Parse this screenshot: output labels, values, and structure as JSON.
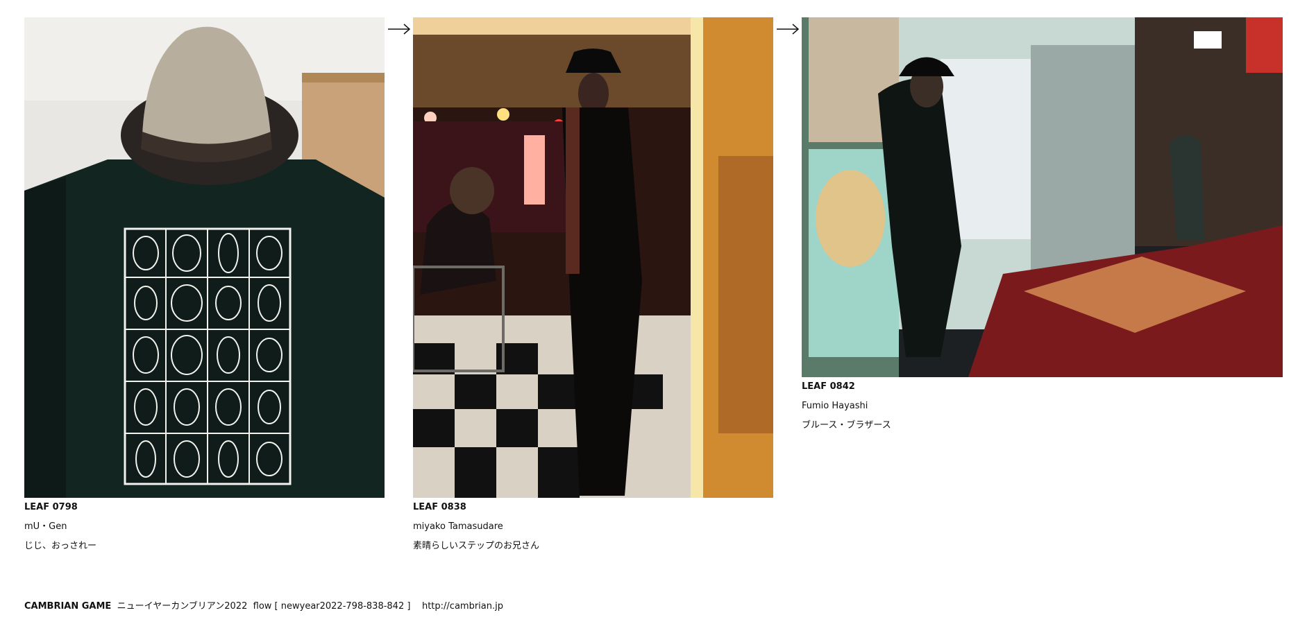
{
  "leaves": [
    {
      "id": "LEAF 0798",
      "author": "mU・Gen",
      "title": "じじ、おっされー",
      "image": "hat-on-tshirt-photo"
    },
    {
      "id": "LEAF 0838",
      "author": "miyako Tamasudare",
      "title": "素晴らしいステップのお兄さん",
      "image": "live-house-man-in-hat-photo"
    },
    {
      "id": "LEAF 0842",
      "author": "Fumio Hayashi",
      "title": "ブルース・ブラザース",
      "image": "blues-brothers-statue-photo"
    }
  ],
  "arrows": [
    "right-arrow-icon",
    "right-arrow-icon"
  ],
  "footer": {
    "game": "CAMBRIAN GAME",
    "event": "ニューイヤーカンブリアン2022",
    "flow": "flow [ newyear2022-798-838-842 ]",
    "url": "http://cambrian.jp"
  }
}
